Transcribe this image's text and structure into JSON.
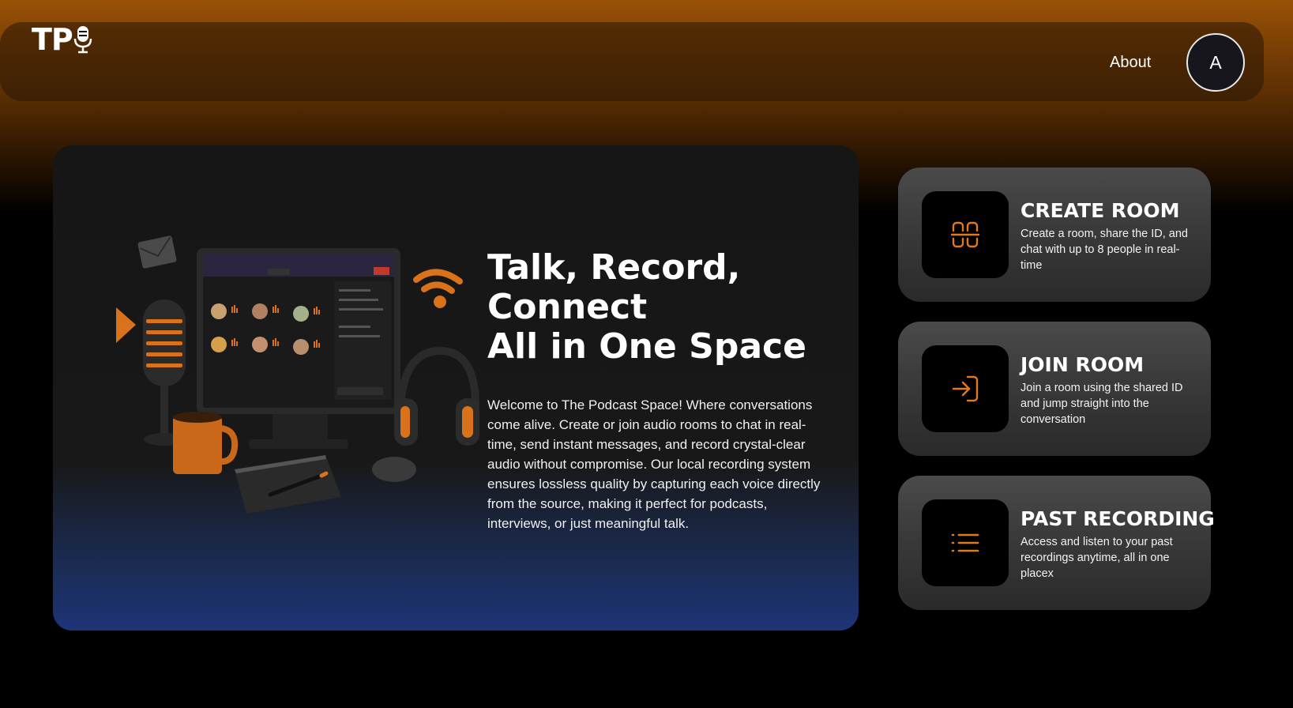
{
  "nav": {
    "logo_text": "TP",
    "about_label": "About",
    "avatar_initial": "A"
  },
  "hero": {
    "title_lines": [
      "Talk, Record,",
      "Connect",
      "All in One Space"
    ],
    "description": "Welcome to The Podcast Space! Where conversations come alive. Create or join audio rooms to chat in real-time, send instant messages, and record crystal-clear audio without compromise. Our local recording system ensures lossless quality by capturing each voice directly from the source, making it perfect for podcasts, interviews, or just meaningful talk."
  },
  "actions": [
    {
      "title": "CREATE ROOM",
      "description": "Create a room, share the ID, and chat with up to 8 people in real-time",
      "icon": "room-split-icon"
    },
    {
      "title": "JOIN ROOM",
      "description": "Join a room using the shared ID and jump straight into the conversation",
      "icon": "login-arrow-icon"
    },
    {
      "title": "PAST RECORDING",
      "description": "Access and listen to your past recordings anytime, all in one placex",
      "icon": "list-icon"
    }
  ],
  "colors": {
    "accent_orange": "#e07a1a",
    "card_bg": "#3a3a3a",
    "hero_blue": "#1d3478"
  }
}
